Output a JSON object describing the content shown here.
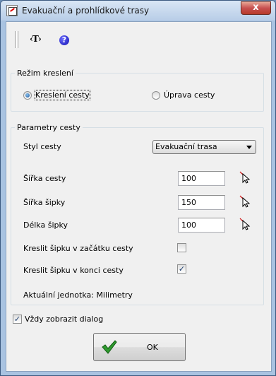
{
  "window": {
    "title": "Evakuační a prohlídkové trasy",
    "close_glyph": "x"
  },
  "toolbar": {
    "text_tool_label": "‹T›",
    "help_glyph": "?"
  },
  "drawing_mode": {
    "legend": "Režim kreslení",
    "options": [
      {
        "label": "Kreslení cesty",
        "selected": true
      },
      {
        "label": "Úprava cesty",
        "selected": false
      }
    ]
  },
  "path_params": {
    "legend": "Parametry cesty",
    "style_label": "Styl cesty",
    "style_value": "Evakuační trasa",
    "path_width_label": "Šířka cesty",
    "path_width_value": "100",
    "arrow_width_label": "Šířka šipky",
    "arrow_width_value": "150",
    "arrow_length_label": "Délka šipky",
    "arrow_length_value": "100",
    "arrow_start_label": "Kreslit šipku v začátku cesty",
    "arrow_start_checked": false,
    "arrow_end_label": "Kreslit šipku v konci cesty",
    "arrow_end_checked": true,
    "units_text": "Aktuální jednotka: Milimetry"
  },
  "always_show": {
    "label": "Vždy zobrazit dialog",
    "checked": true
  },
  "ok_button": {
    "label": "OK"
  },
  "colors": {
    "title_bar": "#b8cde7",
    "client_bg": "#f0f0f0",
    "close_button": "#c75050",
    "checkmark_green": "#2f9a2f"
  }
}
